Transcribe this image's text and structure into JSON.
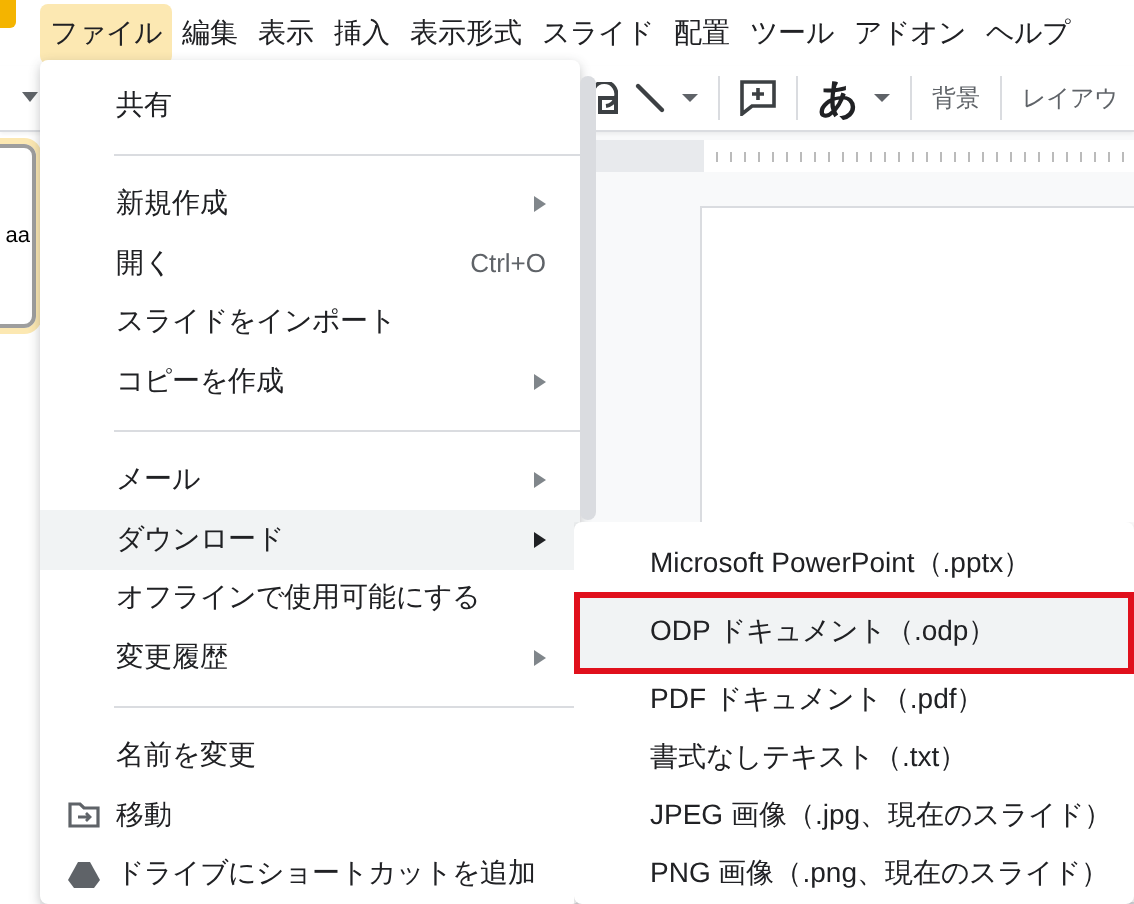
{
  "menubar": {
    "items": [
      {
        "label": "ファイル",
        "selected": true
      },
      {
        "label": "編集",
        "selected": false
      },
      {
        "label": "表示",
        "selected": false
      },
      {
        "label": "挿入",
        "selected": false
      },
      {
        "label": "表示形式",
        "selected": false
      },
      {
        "label": "スライド",
        "selected": false
      },
      {
        "label": "配置",
        "selected": false
      },
      {
        "label": "ツール",
        "selected": false
      },
      {
        "label": "アドオン",
        "selected": false
      },
      {
        "label": "ヘルプ",
        "selected": false
      }
    ]
  },
  "toolbar": {
    "items": [
      {
        "kind": "shape"
      },
      {
        "kind": "line"
      },
      {
        "kind": "caret"
      },
      {
        "kind": "sep"
      },
      {
        "kind": "comment"
      },
      {
        "kind": "sep"
      },
      {
        "kind": "glyph",
        "label": "あ"
      },
      {
        "kind": "caret"
      },
      {
        "kind": "sep"
      },
      {
        "kind": "text",
        "label": "背景"
      },
      {
        "kind": "sep"
      },
      {
        "kind": "text",
        "label": "レイアウ"
      }
    ]
  },
  "slides_panel": {
    "thumbnail_text": "aa",
    "selected": true
  },
  "file_menu": {
    "items": [
      {
        "kind": "item",
        "label": "共有",
        "selected": false
      },
      {
        "kind": "divider"
      },
      {
        "kind": "item",
        "label": "新規作成",
        "submenu": true,
        "selected": false
      },
      {
        "kind": "item",
        "label": "開く",
        "shortcut": "Ctrl+O",
        "selected": false
      },
      {
        "kind": "item",
        "label": "スライドをインポート",
        "selected": false
      },
      {
        "kind": "item",
        "label": "コピーを作成",
        "submenu": true,
        "selected": false
      },
      {
        "kind": "divider"
      },
      {
        "kind": "item",
        "label": "メール",
        "submenu": true,
        "selected": false
      },
      {
        "kind": "item",
        "label": "ダウンロード",
        "submenu": true,
        "selected": true
      },
      {
        "kind": "item",
        "label": "オフラインで使用可能にする",
        "selected": false
      },
      {
        "kind": "item",
        "label": "変更履歴",
        "submenu": true,
        "selected": false
      },
      {
        "kind": "divider"
      },
      {
        "kind": "item",
        "label": "名前を変更",
        "selected": false
      },
      {
        "kind": "folder",
        "label": "移動",
        "selected": false
      },
      {
        "kind": "drive",
        "label": "ドライブにショートカットを追加",
        "selected": false
      }
    ]
  },
  "download_menu": {
    "items": [
      {
        "label": "Microsoft PowerPoint（.pptx）",
        "selected": false,
        "outlined": false
      },
      {
        "label": "ODP ドキュメント（.odp）",
        "selected": true,
        "outlined": true
      },
      {
        "label": "PDF ドキュメント（.pdf）",
        "selected": false,
        "outlined": false
      },
      {
        "label": "書式なしテキスト（.txt）",
        "selected": false,
        "outlined": false
      },
      {
        "label": "JPEG 画像（.jpg、現在のスライド）",
        "selected": false,
        "outlined": false
      },
      {
        "label": "PNG 画像（.png、現在のスライド）",
        "selected": false,
        "outlined": false
      }
    ]
  }
}
